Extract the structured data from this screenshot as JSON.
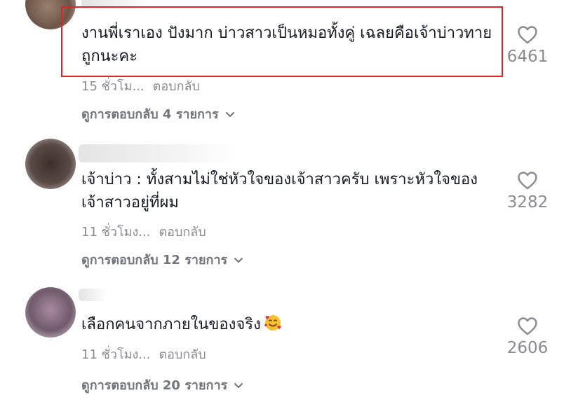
{
  "comments": [
    {
      "text": "งานพี่เราเอง ปังมาก บ่าวสาวเป็นหมอทั้งคู่ เฉลยคือเจ้าบ่าวทายถูกนะคะ",
      "time": "15 ชั่วโม...",
      "reply": "ตอบกลับ",
      "view_replies": "ดูการตอบกลับ 4 รายการ",
      "likes": "6461"
    },
    {
      "text": "เจ้าบ่าว : ทั้งสามไม่ใช่หัวใจของเจ้าสาวครับ เพราะหัวใจของเจ้าสาวอยู่ที่ผม",
      "time": "11 ชั่วโมง...",
      "reply": "ตอบกลับ",
      "view_replies": "ดูการตอบกลับ 12 รายการ",
      "likes": "3282"
    },
    {
      "text": "เลือกคนจากภายในของจริง",
      "emoji": "smiling-face-with-hearts",
      "time": "11 ชั่วโมง...",
      "reply": "ตอบกลับ",
      "view_replies": "ดูการตอบกลับ 20 รายการ",
      "likes": "2606"
    }
  ],
  "colors": {
    "highlight": "#e02424",
    "text": "#161823",
    "muted": "#8a8b91"
  }
}
